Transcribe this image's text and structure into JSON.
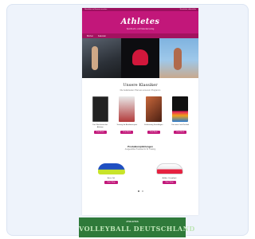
{
  "topbar": {
    "left": "Newsletter im Browser ansehen",
    "right": "Newsletter abbestellen"
  },
  "header": {
    "logo": "Athletes",
    "tagline": "Sportbuch- und Kalenderverlag"
  },
  "nav": {
    "items": [
      "Bücher",
      "Kalender"
    ]
  },
  "section1": {
    "title": "Unsere Klassiker",
    "subtitle": "Die beliebtesten Titel aus unserem Programm",
    "books": [
      {
        "title": "Das Wachstum des Athleten",
        "button": "Zum Buch"
      },
      {
        "title": "Training für Ausdauersport",
        "button": "Zum Buch"
      },
      {
        "title": "Kraftraining Grundlagen",
        "button": "Zum Buch"
      },
      {
        "title": "Die neue Lauf-Technik",
        "button": "Zum Buch"
      }
    ]
  },
  "section2": {
    "title": "Produktempfehlungen",
    "subtitle": "Ausgewählte Produkte für Ihr Training",
    "products": [
      {
        "name": "Asics Gel",
        "button": "Zum Shop"
      },
      {
        "name": "Adidas Crazyflight",
        "button": "Zum Shop"
      }
    ]
  },
  "banner": {
    "logo": "ATHLETES",
    "text": "VOLLEYBALL DEUTSCHLAND"
  },
  "colors": {
    "brand": "#c2177a",
    "banner": "#2f7a3a"
  }
}
